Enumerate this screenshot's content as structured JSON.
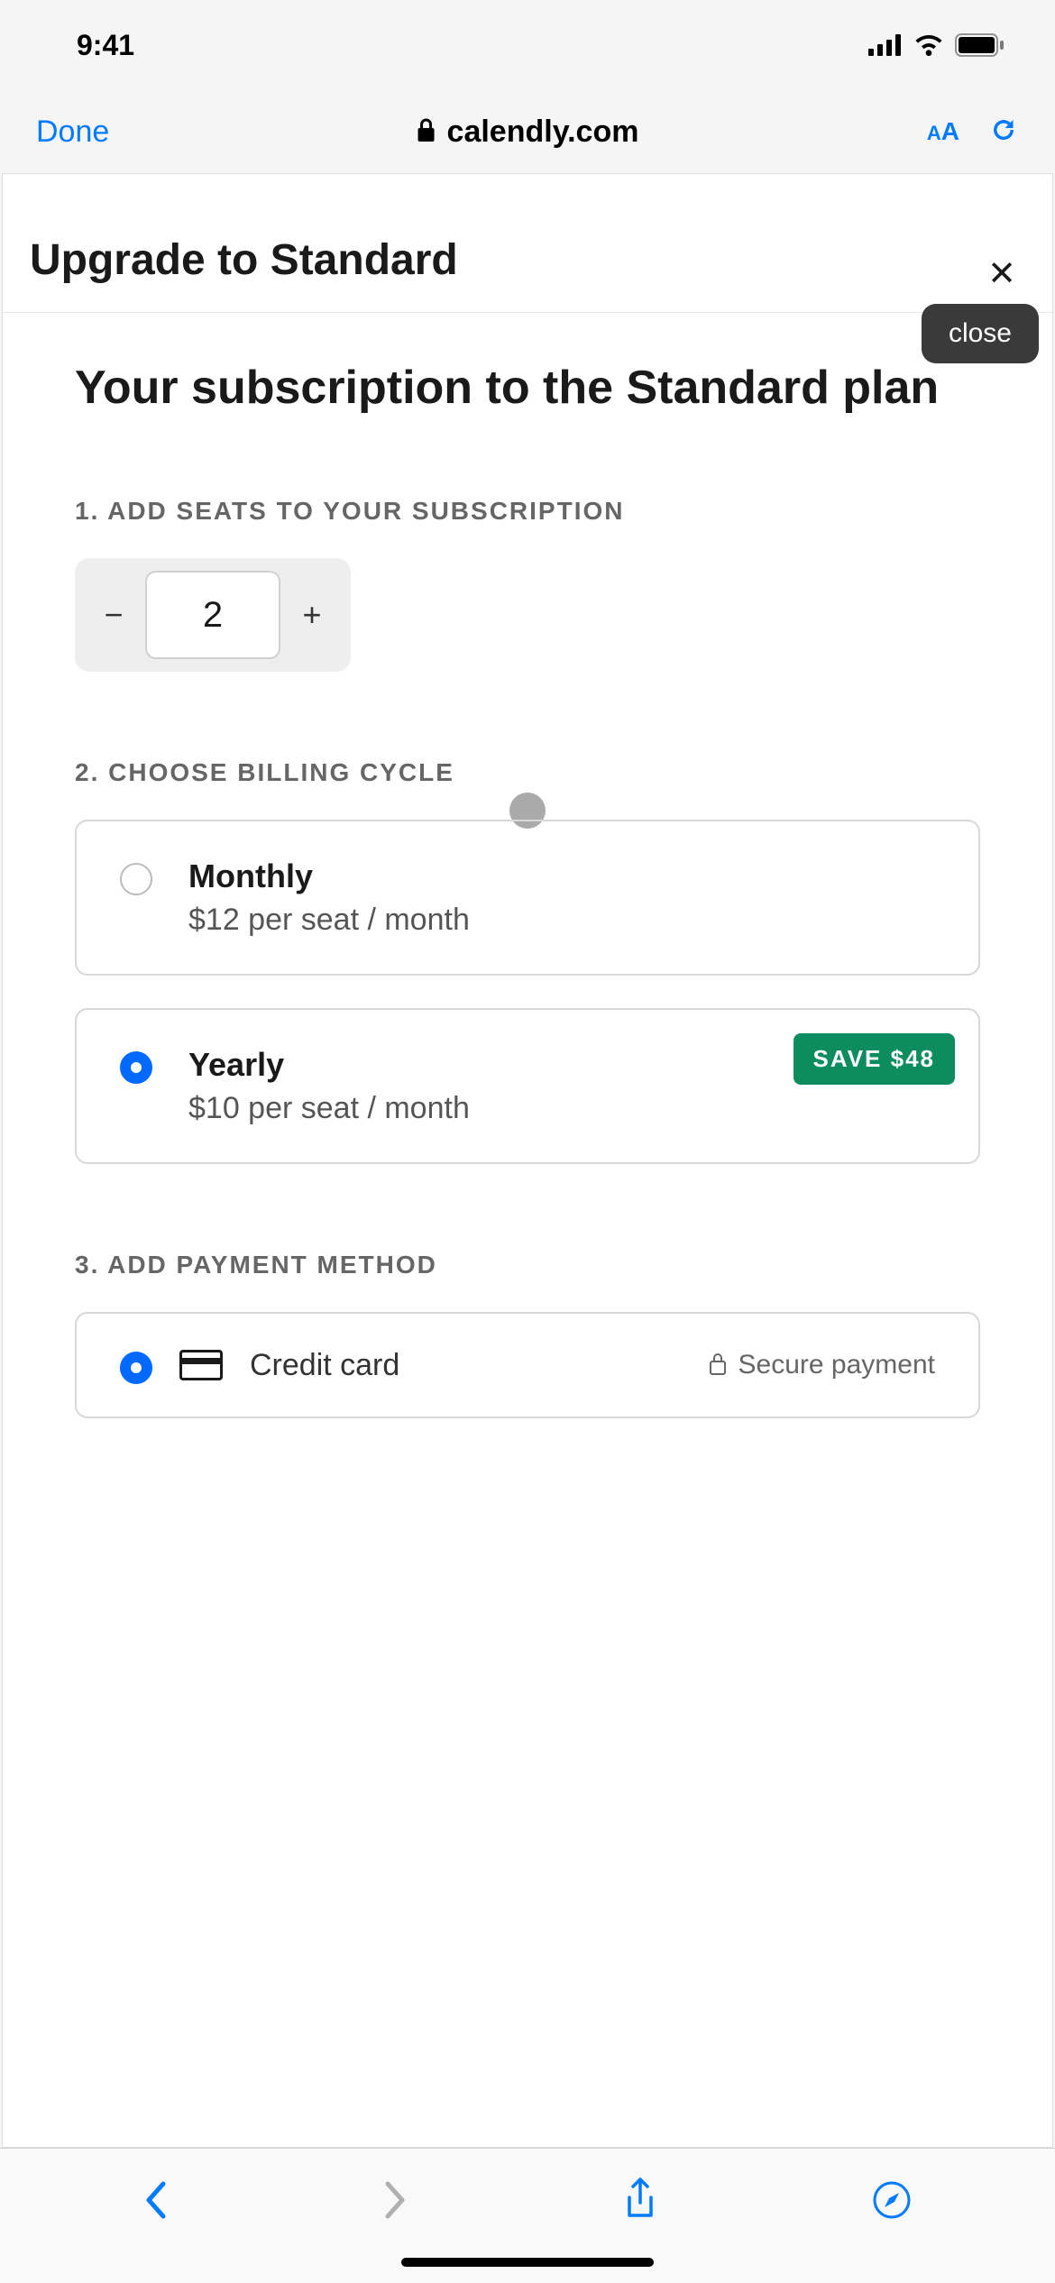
{
  "status": {
    "time": "9:41"
  },
  "safari": {
    "done": "Done",
    "url": "calendly.com",
    "textSize": "aA"
  },
  "modal": {
    "title": "Upgrade to Standard",
    "closeTooltip": "close",
    "subtitle": "Your subscription to the Standard plan",
    "sections": {
      "seats": {
        "label": "1. ADD SEATS TO YOUR SUBSCRIPTION",
        "value": "2"
      },
      "billing": {
        "label": "2. CHOOSE BILLING CYCLE",
        "options": [
          {
            "name": "Monthly",
            "price": "$12 per seat / month",
            "selected": false
          },
          {
            "name": "Yearly",
            "price": "$10 per seat / month",
            "selected": true,
            "badge": "SAVE $48"
          }
        ]
      },
      "payment": {
        "label": "3. ADD PAYMENT METHOD",
        "method": "Credit card",
        "secure": "Secure payment"
      }
    }
  }
}
